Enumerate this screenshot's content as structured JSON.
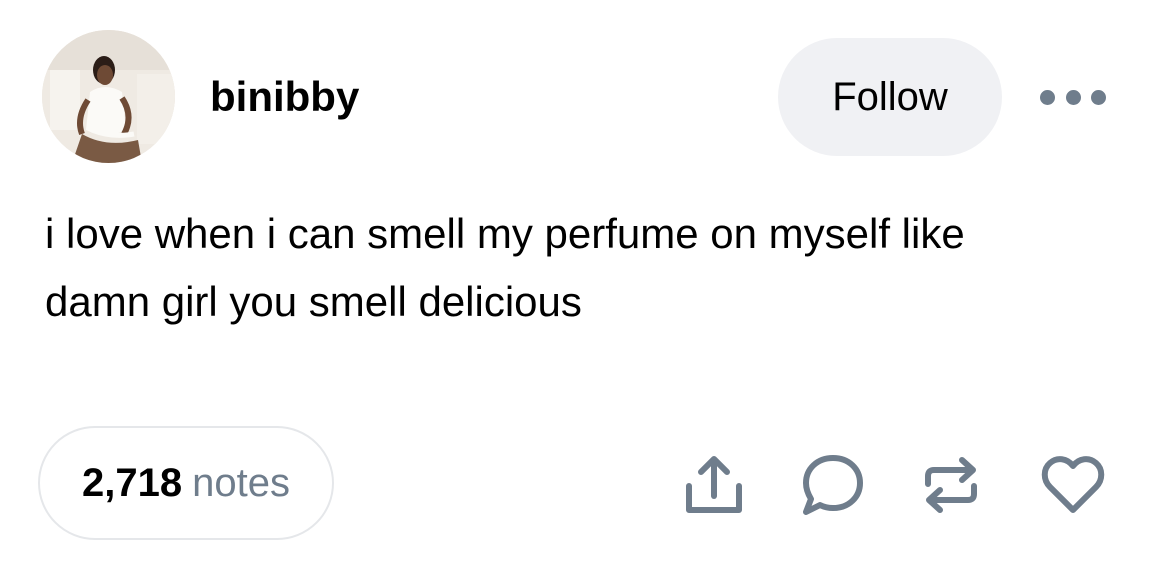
{
  "post": {
    "username": "binibby",
    "follow_label": "Follow",
    "more_icon": "ellipsis-icon",
    "text_lines": [
      "i love when i can smell my perfume on myself like",
      "damn girl you smell delicious"
    ],
    "notes_count": "2,718",
    "notes_label": "notes"
  },
  "icons": {
    "share": "share-icon",
    "reply": "reply-bubble-icon",
    "reblog": "reblog-icon",
    "like": "heart-icon"
  },
  "colors": {
    "icon_gray": "#6f7d8c",
    "follow_bg": "#f0f1f4",
    "notes_border": "#e5e7ea",
    "text": "#000000"
  }
}
